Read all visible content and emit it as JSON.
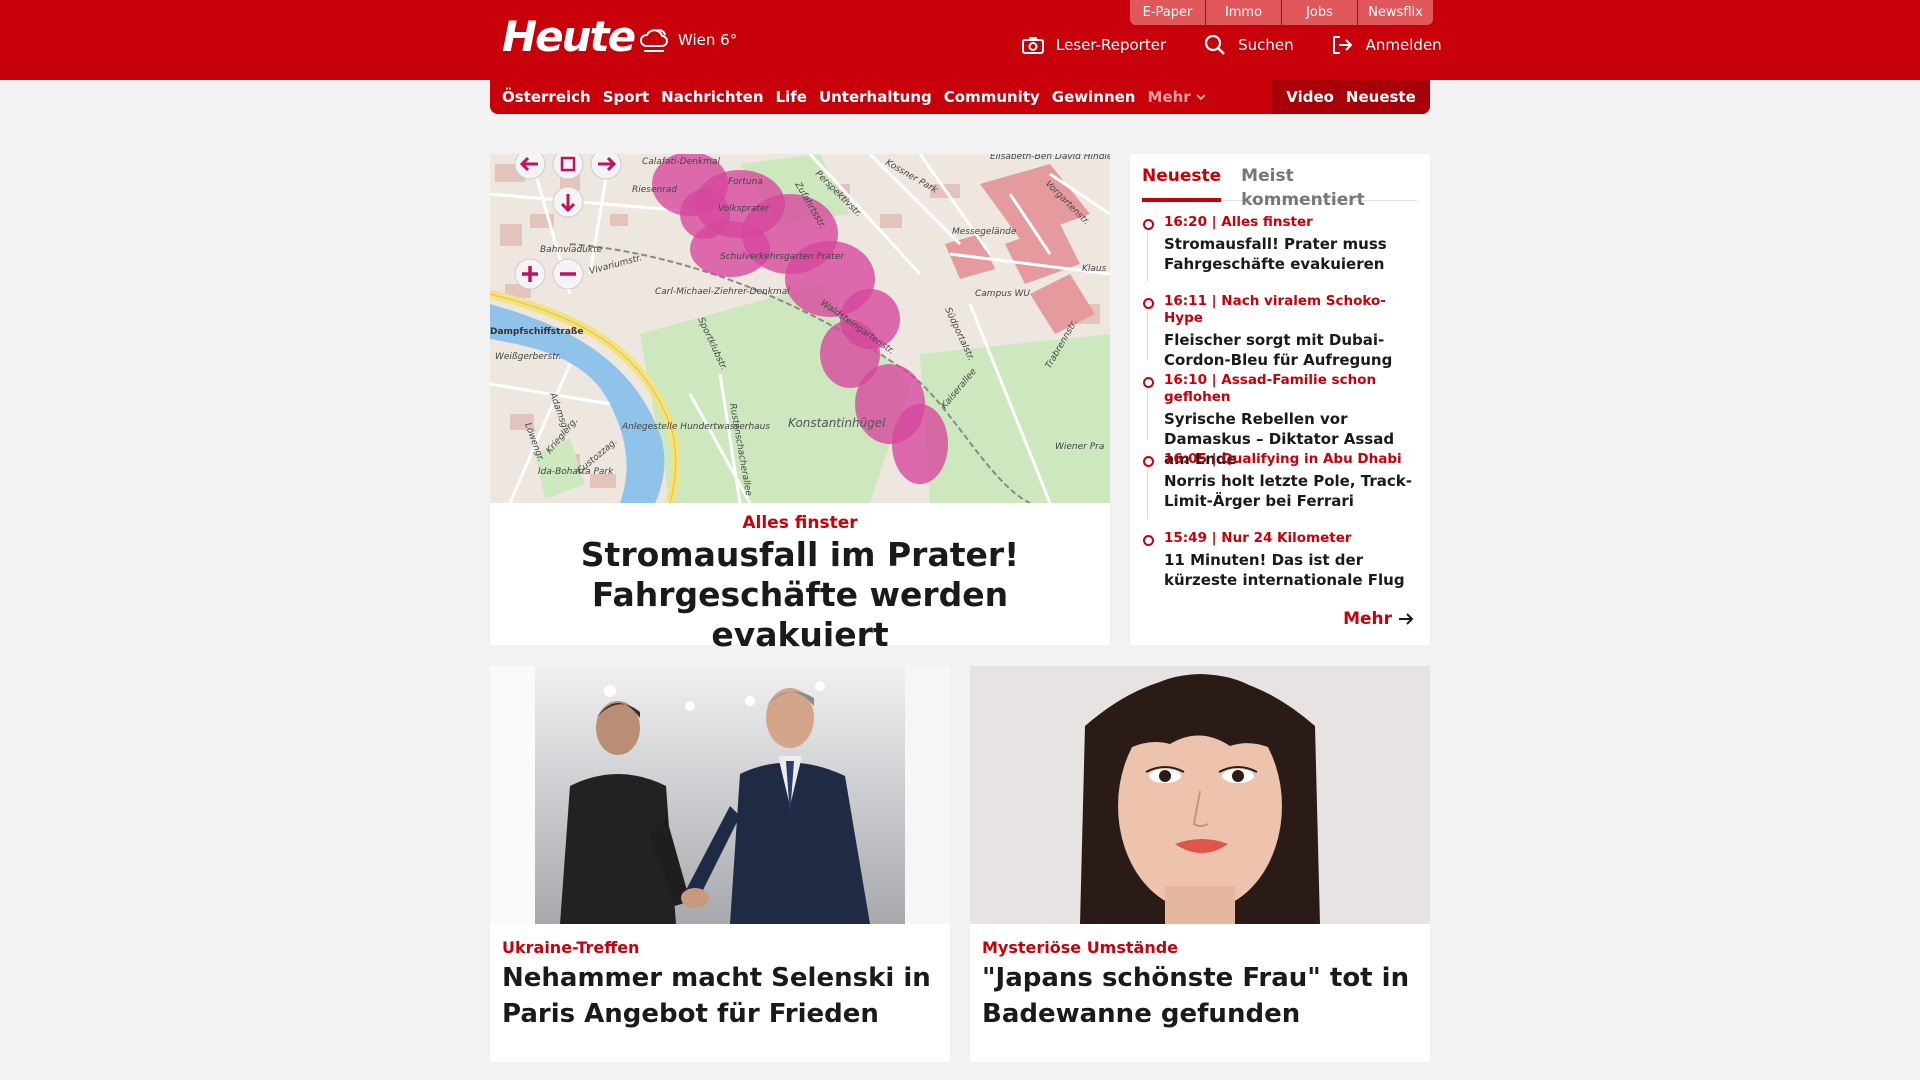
{
  "utility_nav": [
    "E-Paper",
    "Immo",
    "Jobs",
    "Newsflix"
  ],
  "brand": {
    "logo": "Heute",
    "weather": "Wien 6°"
  },
  "header_actions": {
    "reporter": "Leser-Reporter",
    "search": "Suchen",
    "login": "Anmelden"
  },
  "nav": {
    "items": [
      "Österreich",
      "Sport",
      "Nachrichten",
      "Life",
      "Unterhaltung",
      "Community",
      "Gewinnen"
    ],
    "more": "Mehr",
    "video": "Video",
    "latest": "Neueste"
  },
  "lead": {
    "kicker": "Alles finster",
    "headline": "Stromausfall im Prater! Fahrgeschäfte werden evakuiert",
    "map_labels": [
      "Calafati-Denkmal",
      "Riesenrad",
      "Fortuna",
      "Volksprater",
      "Zufahrtsstr.",
      "Perspektivstr.",
      "Kossner Park",
      "Elisabeth-Ben David Hindler Park",
      "Vorgartenstr.",
      "Messegelände",
      "Bahnviadukte",
      "Schulverkehrsgarten Prater",
      "Carl-Michael-Ziehrer-Denkmal",
      "Vivariumstr.",
      "Campus WU",
      "Südportalstr.",
      "Trabrennstr.",
      "Dampfschiffstraße",
      "Weißgerberstr.",
      "Sportklubstr.",
      "Anlegestelle Hundertwasserhaus",
      "Konstantinhügel",
      "Kaiserallee",
      "Wiener Pra",
      "Ida-Bohatta Park",
      "Custozzag.",
      "Krieglerg.",
      "Adamsg.",
      "Löwengr.",
      "Rustenschacherallee",
      "Klaus",
      "Waldsteingartenstr."
    ],
    "colors": {
      "accent": "#c8000a",
      "outage": "#d6459c"
    }
  },
  "sidebar": {
    "tabs": [
      "Neueste",
      "Meist kommentiert"
    ],
    "items": [
      {
        "meta": "16:20 | Alles finster",
        "title": "Stromausfall! Prater muss Fahrgeschäfte evakuieren"
      },
      {
        "meta": "16:11 | Nach viralem Schoko-Hype",
        "title": "Fleischer sorgt mit Dubai-Cordon-Bleu für Aufregung"
      },
      {
        "meta": "16:10 | Assad-Familie schon geflohen",
        "title": "Syrische Rebellen vor Damaskus – Diktator Assad am Ende"
      },
      {
        "meta": "16:05 | Qualifying in Abu Dhabi",
        "title": "Norris holt letzte Pole, Track-Limit-Ärger bei Ferrari"
      },
      {
        "meta": "15:49 | Nur 24 Kilometer",
        "title": "11 Minuten! Das ist der kürzeste internationale Flug"
      }
    ],
    "more": "Mehr"
  },
  "cards": [
    {
      "kicker": "Ukraine-Treffen",
      "headline": "Nehammer macht Selenski in Paris Angebot für Frieden"
    },
    {
      "kicker": "Mysteriöse Umstände",
      "headline": "\"Japans schönste Frau\" tot in Badewanne gefunden"
    }
  ]
}
